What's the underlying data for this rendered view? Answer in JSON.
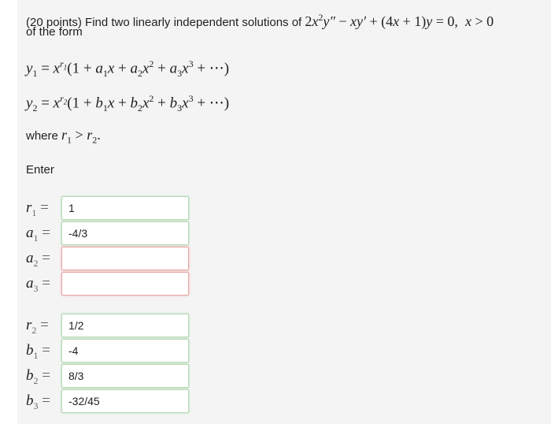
{
  "problem": {
    "points": "(20 points)",
    "intro": "Find two linearly independent solutions of",
    "ode": "2x²y″ − xy′ + (4x + 1)y = 0, x > 0",
    "of_the_form": "of the form"
  },
  "forms": {
    "y1": "y₁ = x^r₁(1 + a₁x + a₂x² + a₃x³ + ⋯)",
    "y2": "y₂ = x^r₂(1 + b₁x + b₂x² + b₃x³ + ⋯)"
  },
  "where": "where r₁ > r₂.",
  "enter_label": "Enter",
  "answers": {
    "r1": "1",
    "a1": "-4/3",
    "a2": "",
    "a3": "",
    "r2": "1/2",
    "b1": "-4",
    "b2": "8/3",
    "b3": "-32/45"
  },
  "colors": {
    "correct_border": "#b9dbb9",
    "empty_border": "#e7a3a3",
    "panel_background": "#f4f4f4"
  }
}
